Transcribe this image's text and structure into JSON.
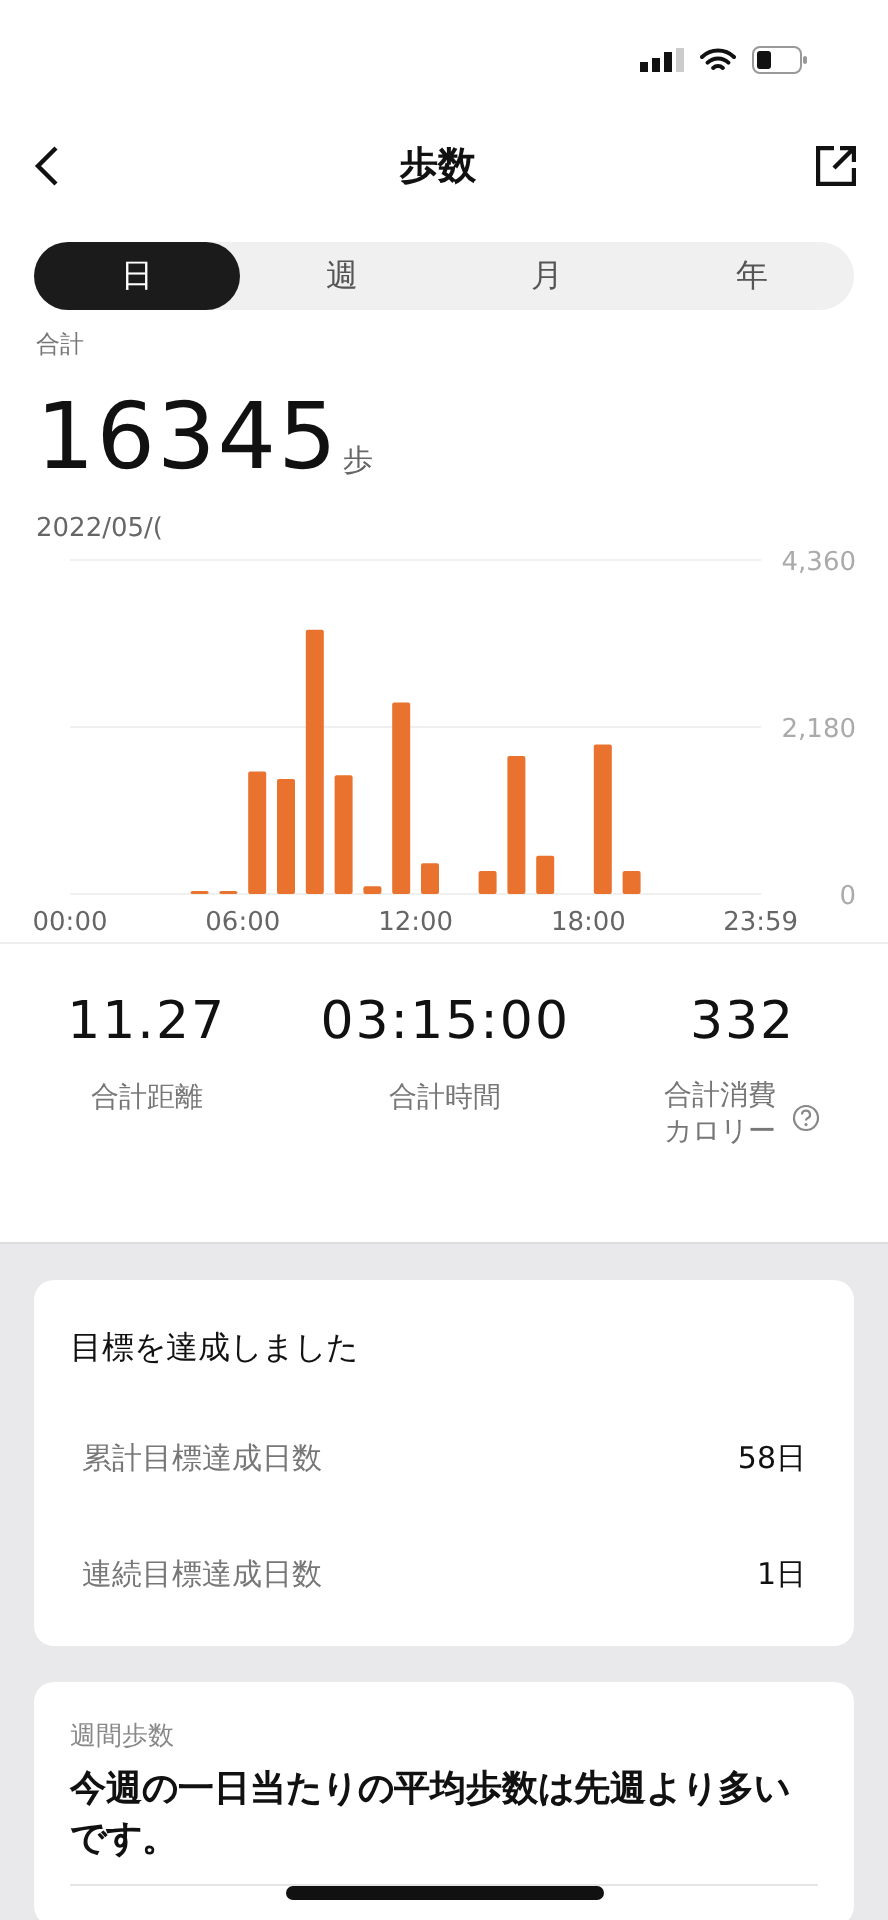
{
  "header": {
    "title": "歩数"
  },
  "tabs": [
    {
      "label": "日",
      "selected": true
    },
    {
      "label": "週",
      "selected": false
    },
    {
      "label": "月",
      "selected": false
    },
    {
      "label": "年",
      "selected": false
    }
  ],
  "summary": {
    "label": "合計",
    "value": "16345",
    "unit": "歩",
    "date": "2022/05/("
  },
  "chart_data": {
    "type": "bar",
    "x": [
      4.5,
      5.5,
      6.5,
      7.5,
      8.5,
      9.5,
      10.5,
      11.5,
      12.5,
      14.5,
      15.5,
      16.5,
      18.5,
      19.5
    ],
    "series": [
      {
        "color": "#e8722e",
        "values": [
          20,
          20,
          1600,
          1500,
          3450,
          1550,
          100,
          2500,
          400,
          300,
          1800,
          500,
          1950,
          300
        ]
      }
    ],
    "xlim": [
      0,
      24
    ],
    "ylim": [
      0,
      4360
    ],
    "yticks": [
      {
        "value": 0,
        "label": "0"
      },
      {
        "value": 2180,
        "label": "2,180"
      },
      {
        "value": 4360,
        "label": "4,360"
      }
    ],
    "xticks": [
      {
        "value": 0,
        "label": "00:00"
      },
      {
        "value": 6,
        "label": "06:00"
      },
      {
        "value": 12,
        "label": "12:00"
      },
      {
        "value": 18,
        "label": "18:00"
      },
      {
        "value": 23.98,
        "label": "23:59"
      }
    ]
  },
  "stats": [
    {
      "value": "11.27",
      "label": "合計距離",
      "help_icon": false
    },
    {
      "value": "03:15:00",
      "label": "合計時間",
      "help_icon": false
    },
    {
      "value": "332",
      "label": "合計消費カロリー",
      "help_icon": true
    }
  ],
  "goal_card": {
    "title": "目標を達成しました",
    "rows": [
      {
        "label": "累計目標達成日数",
        "value": "58日"
      },
      {
        "label": "連続目標達成日数",
        "value": "1日"
      }
    ]
  },
  "weekly_card": {
    "label": "週間歩数",
    "headline": "今週の一日当たりの平均歩数は先週より多いです。"
  }
}
